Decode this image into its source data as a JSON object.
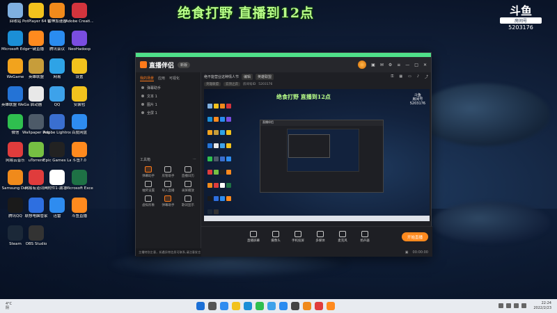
{
  "overlay": {
    "title": "绝食打野 直播到12点",
    "logo_mark": "斗鱼",
    "logo_sub": "房间号",
    "room_number": "5203176"
  },
  "desktop_icons": [
    {
      "label": "回收站",
      "color": "#7fb0e0"
    },
    {
      "label": "PotPlayer 64 bit",
      "color": "#f2c21d"
    },
    {
      "label": "雷神加速器",
      "color": "#f08a1b"
    },
    {
      "label": "Adobe Creati...",
      "color": "#d3343d"
    },
    {
      "label": "Microsoft Edge",
      "color": "#1b8fd6"
    },
    {
      "label": "一键直播",
      "color": "#ff8a1e"
    },
    {
      "label": "腾讯会议",
      "color": "#2a8cf0"
    },
    {
      "label": "NeoHadoop",
      "color": "#7a4de0"
    },
    {
      "label": "WeGame",
      "color": "#f2a31d"
    },
    {
      "label": "英雄联盟",
      "color": "#c79d3a"
    },
    {
      "label": "网易",
      "color": "#2ea3e6"
    },
    {
      "label": "设置",
      "color": "#f2c21d"
    },
    {
      "label": "英雄联盟 WeGame版",
      "color": "#2473d6"
    },
    {
      "label": "启动器",
      "color": "#e8e8e8"
    },
    {
      "label": "QQ",
      "color": "#3da2ea"
    },
    {
      "label": "安装包",
      "color": "#f2c21d"
    },
    {
      "label": "微信",
      "color": "#2fbf4f"
    },
    {
      "label": "Wallpaper Engine",
      "color": "#4d5a68"
    },
    {
      "label": "Adobe Lightroom",
      "color": "#3a6fd0"
    },
    {
      "label": "百度网盘",
      "color": "#2e8cf0"
    },
    {
      "label": "网易云音乐",
      "color": "#e03c3c"
    },
    {
      "label": "uTorrent",
      "color": "#76c043"
    },
    {
      "label": "Epic Games Launcher",
      "color": "#222222"
    },
    {
      "label": "斗鱼7.0",
      "color": "#ff8a1e"
    },
    {
      "label": "Samsung DeX",
      "color": "#f08a1b"
    },
    {
      "label": "网易有道词典",
      "color": "#e03c3c"
    },
    {
      "label": "附件1-湖北",
      "color": "#ffffff"
    },
    {
      "label": "Microsoft Excel",
      "color": "#1e7145"
    },
    {
      "label": "腾讯QQ",
      "color": "#1a1a1a"
    },
    {
      "label": "联想电脑管家",
      "color": "#2e6fe0"
    },
    {
      "label": "迅雷",
      "color": "#2e8cf0"
    },
    {
      "label": "斗鱼直播",
      "color": "#ff8a1e"
    },
    {
      "label": "Steam",
      "color": "#1b2838"
    },
    {
      "label": "OBS Studio",
      "color": "#333333"
    }
  ],
  "app": {
    "brand": "直播伴侣",
    "version": "新版",
    "left_tabs": [
      "我的场景",
      "应用",
      "可视化"
    ],
    "layers": [
      "弹幕助手",
      "文本 1",
      "图片 1",
      "全屏 1"
    ],
    "tools_title": "工具箱",
    "tools": [
      {
        "label": "弹幕助手",
        "highlight": true
      },
      {
        "label": "房管助手",
        "highlight": false
      },
      {
        "label": "直播日历",
        "highlight": false
      },
      {
        "label": "抽奖设置",
        "highlight": false
      },
      {
        "label": "导入直播",
        "highlight": false
      },
      {
        "label": "录屏播放",
        "highlight": false
      },
      {
        "label": "虚拟形象",
        "highlight": false
      },
      {
        "label": "弹幕助手",
        "highlight": true
      },
      {
        "label": "歌词显示",
        "highlight": false
      }
    ],
    "notice": "主播特别主意，如遇异常信息可联系,请注意发言",
    "stream_title": "绝不能营业这种情人节",
    "edit_label": "编辑",
    "category": "英雄联盟",
    "sub_info": [
      "英雄联盟",
      "云顶之弈"
    ],
    "room_id_label": "房间号ID",
    "room_id": "5203176",
    "preview_title": "绝食打野 直播到12点",
    "controls": [
      "直播屏幕",
      "摄像头",
      "手机投屏",
      "多媒体",
      "麦克风",
      "扬声器"
    ],
    "go_live": "开始直播",
    "status": [
      "00:00:00"
    ]
  },
  "taskbar": {
    "weather_temp": "4°C",
    "weather_desc": "阴",
    "time": "22:24",
    "date": "2022/2/23"
  }
}
